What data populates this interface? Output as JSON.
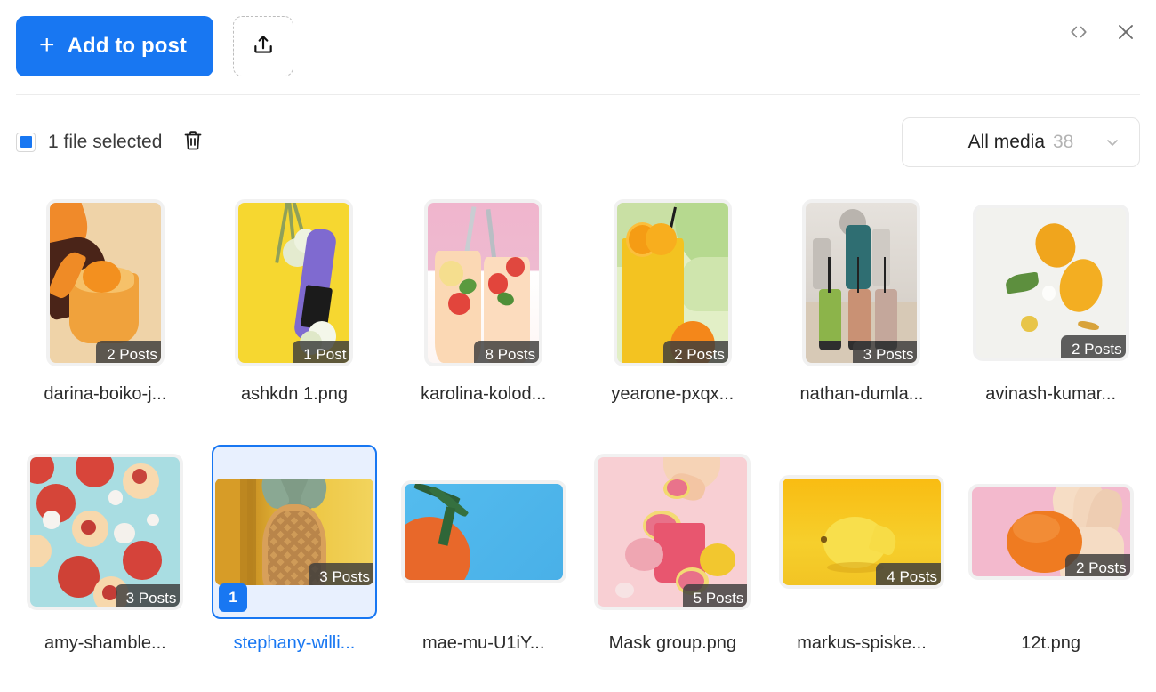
{
  "header": {
    "add_post_label": "Add to post",
    "plus_icon": "plus-icon",
    "upload_icon": "upload-icon",
    "code_icon": "code-brackets-icon",
    "close_icon": "close-icon"
  },
  "toolbar": {
    "selection_label": "1 file selected",
    "checkbox_state": "indeterminate",
    "delete_icon": "trash-icon",
    "media_filter": {
      "label": "All media",
      "count": "38",
      "chevron_icon": "chevron-down-icon"
    }
  },
  "accent_color": "#1877f2",
  "badge_color": "rgba(60,60,60,.82)",
  "media": [
    {
      "filename": "darina-boiko-j...",
      "badge": "2 Posts",
      "shape": "portrait",
      "selected": false,
      "art": "cocktail-orange"
    },
    {
      "filename": "ashkdn 1.png",
      "badge": "1 Post",
      "shape": "portrait",
      "selected": false,
      "art": "bottle-yellow"
    },
    {
      "filename": "karolina-kolod...",
      "badge": "8 Posts",
      "shape": "portrait",
      "selected": false,
      "art": "lemonade-pink"
    },
    {
      "filename": "yearone-pxqx...",
      "badge": "2 Posts",
      "shape": "portrait",
      "selected": false,
      "art": "juice-palm"
    },
    {
      "filename": "nathan-dumla...",
      "badge": "3 Posts",
      "shape": "portrait",
      "selected": false,
      "art": "smoothies-cafe"
    },
    {
      "filename": "avinash-kumar...",
      "badge": "2 Posts",
      "shape": "square",
      "selected": false,
      "art": "mango-white"
    },
    {
      "filename": "amy-shamble...",
      "badge": "3 Posts",
      "shape": "square",
      "selected": false,
      "art": "peaches-teal"
    },
    {
      "filename": "stephany-willi...",
      "badge": "3 Posts",
      "number": "1",
      "shape": "land-md",
      "selected": true,
      "art": "pineapple-yellow"
    },
    {
      "filename": "mae-mu-U1iY...",
      "badge": "",
      "shape": "land",
      "selected": false,
      "art": "orange-blue"
    },
    {
      "filename": "Mask group.png",
      "badge": "5 Posts",
      "shape": "square",
      "selected": false,
      "art": "grapefruit-pink"
    },
    {
      "filename": "markus-spiske...",
      "badge": "4 Posts",
      "shape": "land-md",
      "selected": false,
      "art": "lemon-yellow"
    },
    {
      "filename": "12t.png",
      "badge": "2 Posts",
      "shape": "land-sm",
      "selected": false,
      "art": "orange-hand-pink"
    }
  ]
}
